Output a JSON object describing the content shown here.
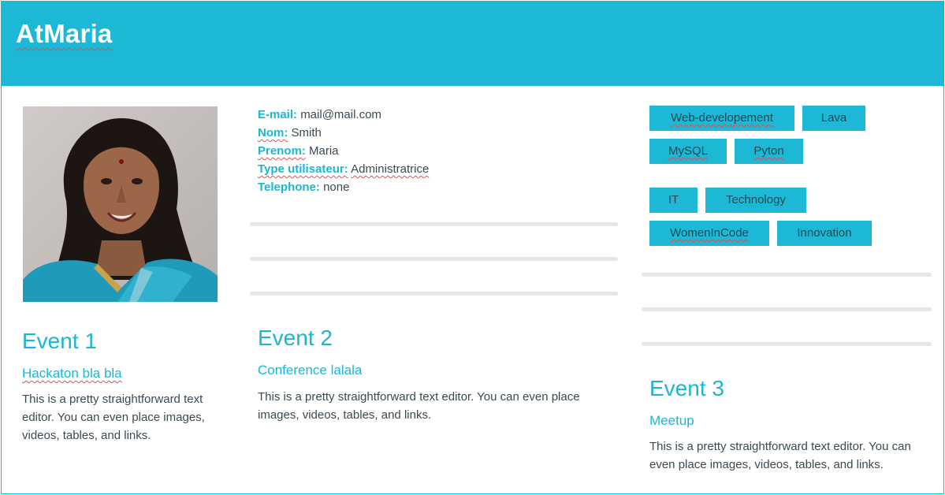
{
  "header": {
    "brand": "AtMaria"
  },
  "profile": {
    "fields": [
      {
        "label": "E-mail:",
        "value": "mail@mail.com"
      },
      {
        "label": "Nom:",
        "value": "Smith"
      },
      {
        "label": "Prenom:",
        "value": "Maria"
      },
      {
        "label": "Type utilisateur:",
        "value": "Administratrice"
      },
      {
        "label": "Telephone:",
        "value": "none"
      }
    ]
  },
  "tags": {
    "group1": [
      "Web-developement",
      "Lava",
      "MySQL",
      "Pyton"
    ],
    "group2": [
      "IT",
      "Technology",
      "WomenInCode",
      "Innovation"
    ]
  },
  "events": [
    {
      "title": "Event 1",
      "subtitle": "Hackaton bla bla",
      "body": "This is a pretty straightforward text editor. You can even place images, videos, tables, and links."
    },
    {
      "title": "Event 2",
      "subtitle": "Conference lalala",
      "body": "This is a pretty straightforward text editor. You can even place images, videos, tables, and links."
    },
    {
      "title": "Event 3",
      "subtitle": "Meetup",
      "body": "This is a pretty straightforward text editor. You can even place images, videos, tables, and links."
    }
  ],
  "colors": {
    "accent": "#1cb8d5",
    "text": "#3a4a52",
    "divider": "#e6e6e6"
  }
}
